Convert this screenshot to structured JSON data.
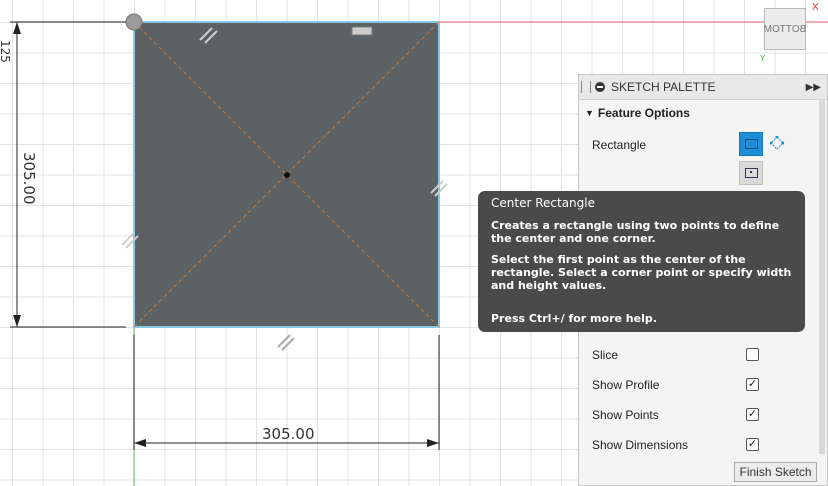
{
  "sketch": {
    "dim_width": "305.00",
    "dim_height": "305.00",
    "dim_partial": "125"
  },
  "viewcube": {
    "face_label": "BOTTOM",
    "x_axis": "X",
    "y_axis": "Y"
  },
  "palette": {
    "title": "SKETCH PALETTE",
    "section_title": "Feature Options",
    "rectangle_label": "Rectangle",
    "options": [
      {
        "label": "Slice",
        "checked": false
      },
      {
        "label": "Show Profile",
        "checked": true
      },
      {
        "label": "Show Points",
        "checked": true
      },
      {
        "label": "Show Dimensions",
        "checked": true
      }
    ],
    "finish_label": "Finish Sketch"
  },
  "tooltip": {
    "title": "Center Rectangle",
    "paragraph1": "Creates a rectangle using two points to define the center and one corner.",
    "paragraph2": "Select the first point as the center of the rectangle. Select a corner point or specify width and height values.",
    "paragraph3": "Press Ctrl+/ for more help."
  },
  "colors": {
    "profile_fill": "#5c6263",
    "sketch_line": "#88c6e5",
    "construction_line": "#c8773a",
    "accent": "#1c8fd6"
  }
}
